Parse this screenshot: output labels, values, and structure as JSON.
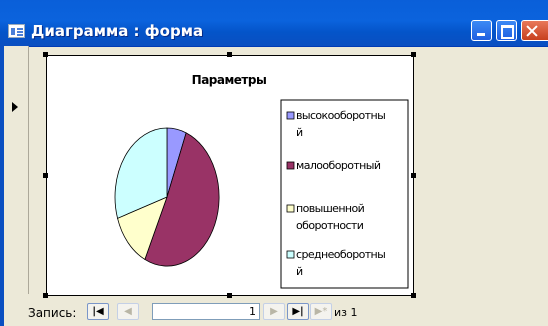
{
  "window": {
    "title": "Диаграмма : форма",
    "icon": "form-icon"
  },
  "chart_data": {
    "type": "pie",
    "title": "Параметры",
    "slices": [
      {
        "label": "высокооборотный",
        "value": 6,
        "color": "#9999ff"
      },
      {
        "label": "малооборотный",
        "value": 51,
        "color": "#993366"
      },
      {
        "label": "повышенной оборотности",
        "value": 13,
        "color": "#ffffcc"
      },
      {
        "label": "среднеоборотный",
        "value": 30,
        "color": "#ccffff"
      }
    ],
    "legend_placement": "right",
    "legend_lines": [
      [
        "высокооборотны",
        "й"
      ],
      [
        "малооборотный"
      ],
      [
        "повышенной",
        "оборотности"
      ],
      [
        "среднеоборотны",
        "й"
      ]
    ]
  },
  "navigation": {
    "record_label": "Запись:",
    "current_record": "1",
    "total_text": "из  1",
    "first_icon": "first-record-icon",
    "prev_icon": "prev-record-icon",
    "next_icon": "next-record-icon",
    "last_icon": "last-record-icon",
    "new_icon": "new-record-icon"
  }
}
